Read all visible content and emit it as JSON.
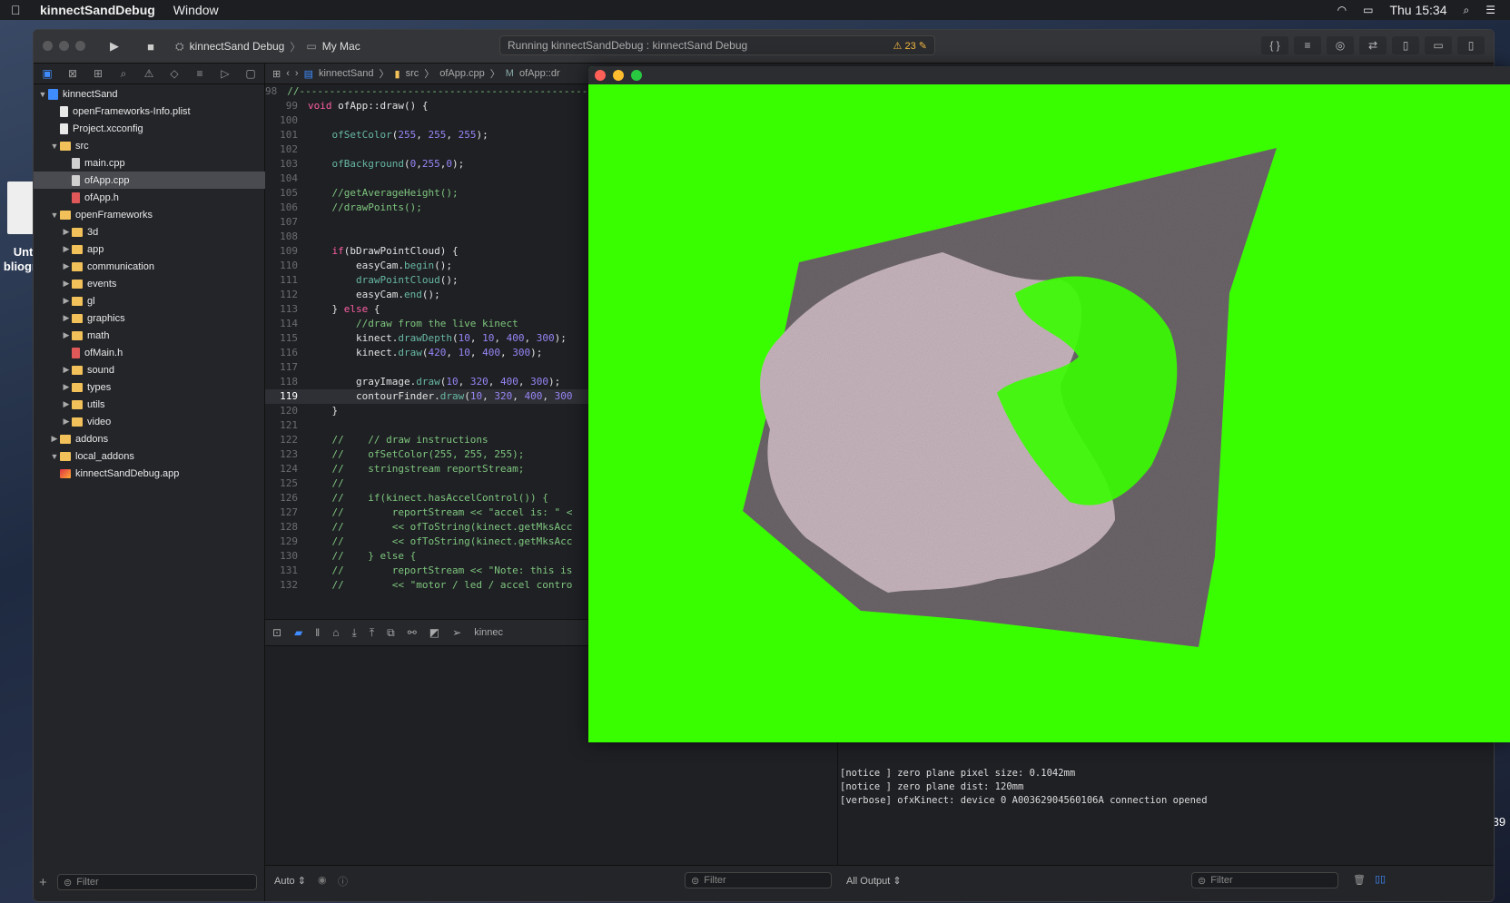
{
  "menubar": {
    "app_name": "kinnectSandDebug",
    "menu_window": "Window",
    "clock": "Thu 15:34"
  },
  "desktop": {
    "file_label_1": "Unti",
    "file_label_2": "bliogr",
    "right_number": ".39"
  },
  "toolbar": {
    "scheme": "kinnectSand Debug",
    "destination": "My Mac",
    "activity": "Running kinnectSandDebug : kinnectSand Debug",
    "warning_count": "23"
  },
  "navigator": {
    "items": [
      {
        "label": "kinnectSand",
        "indent": 0,
        "arrow": "▼",
        "kind": "proj"
      },
      {
        "label": "openFrameworks-Info.plist",
        "indent": 1,
        "arrow": "",
        "kind": "file"
      },
      {
        "label": "Project.xcconfig",
        "indent": 1,
        "arrow": "",
        "kind": "file"
      },
      {
        "label": "src",
        "indent": 1,
        "arrow": "▼",
        "kind": "folder"
      },
      {
        "label": "main.cpp",
        "indent": 2,
        "arrow": "",
        "kind": "cpp"
      },
      {
        "label": "ofApp.cpp",
        "indent": 2,
        "arrow": "",
        "kind": "cpp",
        "selected": true
      },
      {
        "label": "ofApp.h",
        "indent": 2,
        "arrow": "",
        "kind": "h"
      },
      {
        "label": "openFrameworks",
        "indent": 1,
        "arrow": "▼",
        "kind": "folder"
      },
      {
        "label": "3d",
        "indent": 2,
        "arrow": "▶",
        "kind": "folder"
      },
      {
        "label": "app",
        "indent": 2,
        "arrow": "▶",
        "kind": "folder"
      },
      {
        "label": "communication",
        "indent": 2,
        "arrow": "▶",
        "kind": "folder"
      },
      {
        "label": "events",
        "indent": 2,
        "arrow": "▶",
        "kind": "folder"
      },
      {
        "label": "gl",
        "indent": 2,
        "arrow": "▶",
        "kind": "folder"
      },
      {
        "label": "graphics",
        "indent": 2,
        "arrow": "▶",
        "kind": "folder"
      },
      {
        "label": "math",
        "indent": 2,
        "arrow": "▶",
        "kind": "folder"
      },
      {
        "label": "ofMain.h",
        "indent": 2,
        "arrow": "",
        "kind": "h"
      },
      {
        "label": "sound",
        "indent": 2,
        "arrow": "▶",
        "kind": "folder"
      },
      {
        "label": "types",
        "indent": 2,
        "arrow": "▶",
        "kind": "folder"
      },
      {
        "label": "utils",
        "indent": 2,
        "arrow": "▶",
        "kind": "folder"
      },
      {
        "label": "video",
        "indent": 2,
        "arrow": "▶",
        "kind": "folder"
      },
      {
        "label": "addons",
        "indent": 1,
        "arrow": "▶",
        "kind": "folder"
      },
      {
        "label": "local_addons",
        "indent": 1,
        "arrow": "▼",
        "kind": "folder"
      },
      {
        "label": "kinnectSandDebug.app",
        "indent": 1,
        "arrow": "",
        "kind": "app"
      }
    ],
    "filter_placeholder": "Filter"
  },
  "jumpbar": {
    "project": "kinnectSand",
    "folder": "src",
    "file": "ofApp.cpp",
    "symbol": "ofApp::dr"
  },
  "code": {
    "current_line": 119,
    "lines": [
      {
        "n": "98",
        "t": "//--------------------------------------------------",
        "k": "cm"
      },
      {
        "n": "99",
        "t": "void ofApp::draw() {",
        "k": "def"
      },
      {
        "n": "100",
        "t": "",
        "k": "plain"
      },
      {
        "n": "101",
        "t": "    ofSetColor(255, 255, 255);",
        "k": "call"
      },
      {
        "n": "102",
        "t": "",
        "k": "plain"
      },
      {
        "n": "103",
        "t": "    ofBackground(0,255,0);",
        "k": "call"
      },
      {
        "n": "104",
        "t": "",
        "k": "plain"
      },
      {
        "n": "105",
        "t": "    //getAverageHeight();",
        "k": "cm"
      },
      {
        "n": "106",
        "t": "    //drawPoints();",
        "k": "cm"
      },
      {
        "n": "107",
        "t": "",
        "k": "plain"
      },
      {
        "n": "108",
        "t": "",
        "k": "plain"
      },
      {
        "n": "109",
        "t": "    if(bDrawPointCloud) {",
        "k": "if"
      },
      {
        "n": "110",
        "t": "        easyCam.begin();",
        "k": "call"
      },
      {
        "n": "111",
        "t": "        drawPointCloud();",
        "k": "call"
      },
      {
        "n": "112",
        "t": "        easyCam.end();",
        "k": "call"
      },
      {
        "n": "113",
        "t": "    } else {",
        "k": "else"
      },
      {
        "n": "114",
        "t": "        //draw from the live kinect",
        "k": "cm"
      },
      {
        "n": "115",
        "t": "        kinect.drawDepth(10, 10, 400, 300);",
        "k": "call"
      },
      {
        "n": "116",
        "t": "        kinect.draw(420, 10, 400, 300);",
        "k": "call"
      },
      {
        "n": "117",
        "t": "",
        "k": "plain"
      },
      {
        "n": "118",
        "t": "        grayImage.draw(10, 320, 400, 300);",
        "k": "call"
      },
      {
        "n": "119",
        "t": "        contourFinder.draw(10, 320, 400, 300",
        "k": "call"
      },
      {
        "n": "120",
        "t": "    }",
        "k": "plain"
      },
      {
        "n": "121",
        "t": "",
        "k": "plain"
      },
      {
        "n": "122",
        "t": "    //    // draw instructions",
        "k": "cm"
      },
      {
        "n": "123",
        "t": "    //    ofSetColor(255, 255, 255);",
        "k": "cm"
      },
      {
        "n": "124",
        "t": "    //    stringstream reportStream;",
        "k": "cm"
      },
      {
        "n": "125",
        "t": "    //",
        "k": "cm"
      },
      {
        "n": "126",
        "t": "    //    if(kinect.hasAccelControl()) {",
        "k": "cm"
      },
      {
        "n": "127",
        "t": "    //        reportStream << \"accel is: \" <",
        "k": "cm"
      },
      {
        "n": "128",
        "t": "    //        << ofToString(kinect.getMksAcc",
        "k": "cm"
      },
      {
        "n": "129",
        "t": "    //        << ofToString(kinect.getMksAcc",
        "k": "cm"
      },
      {
        "n": "130",
        "t": "    //    } else {",
        "k": "cm"
      },
      {
        "n": "131",
        "t": "    //        reportStream << \"Note: this is",
        "k": "cm"
      },
      {
        "n": "132",
        "t": "    //        << \"motor / led / accel contro",
        "k": "cm"
      }
    ]
  },
  "debugbar": {
    "process": "kinnec"
  },
  "console": {
    "lines": [
      "[notice ] zero plane pixel size: 0.1042mm",
      "[notice ] zero plane dist: 120mm",
      "[verbose] ofxKinect: device 0 A00362904560106A connection opened"
    ]
  },
  "bottombar": {
    "auto_label": "Auto",
    "var_filter": "Filter",
    "output_selector": "All Output",
    "console_filter": "Filter"
  },
  "app_window": {
    "background_color": "#39fe00"
  }
}
